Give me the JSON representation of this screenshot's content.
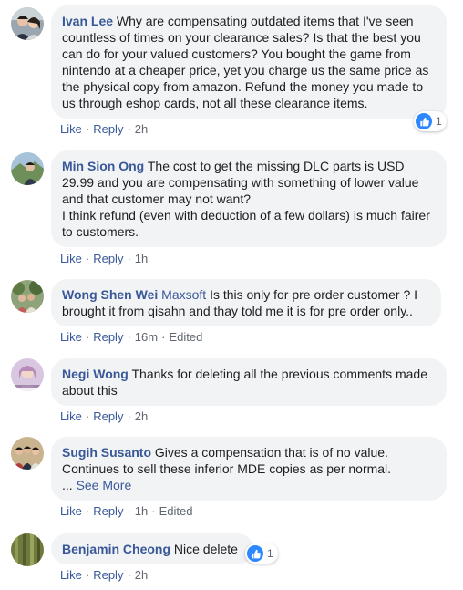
{
  "comments": [
    {
      "author": "Ivan Lee",
      "text": "Why are compensating outdated items that I've seen countless of times on your clearance sales? Is that the best you can do for your valued customers? You bought the game from nintendo at a cheaper price, yet you charge us the same price as the physical copy from amazon. Refund the money you made to us through eshop cards, not all these clearance items.",
      "like": "Like",
      "reply": "Reply",
      "time": "2h",
      "reactions": "1"
    },
    {
      "author": "Min Sion Ong",
      "text": "The cost to get the missing DLC parts is USD 29.99 and you are compensating with something of lower value and that customer may not want?",
      "text2": "I think refund (even with deduction of a few dollars) is much fairer to customers.",
      "like": "Like",
      "reply": "Reply",
      "time": "1h"
    },
    {
      "author": "Wong Shen Wei",
      "mention": "Maxsoft",
      "text": "Is this only for pre order customer ? I brought it from qisahn and thay told me it is for pre order only..",
      "like": "Like",
      "reply": "Reply",
      "time": "16m",
      "edited": "Edited"
    },
    {
      "author": "Negi Wong",
      "text": "Thanks for deleting all the previous comments made about this",
      "like": "Like",
      "reply": "Reply",
      "time": "2h"
    },
    {
      "author": "Sugih Susanto",
      "text": "Gives a compensation that is of no value. Continues to sell these inferior MDE copies as per normal.",
      "ellipsis": "...",
      "see_more": "See More",
      "like": "Like",
      "reply": "Reply",
      "time": "1h",
      "edited": "Edited"
    },
    {
      "author": "Benjamin Cheong",
      "text": "Nice delete",
      "like": "Like",
      "reply": "Reply",
      "time": "2h",
      "reactions": "1"
    }
  ],
  "colors": {
    "bubble": "#f2f3f5",
    "author": "#385898",
    "meta": "#606770",
    "like_blue": "#2d88ff"
  },
  "icons": {
    "like_reaction": "thumbs-up-icon"
  }
}
